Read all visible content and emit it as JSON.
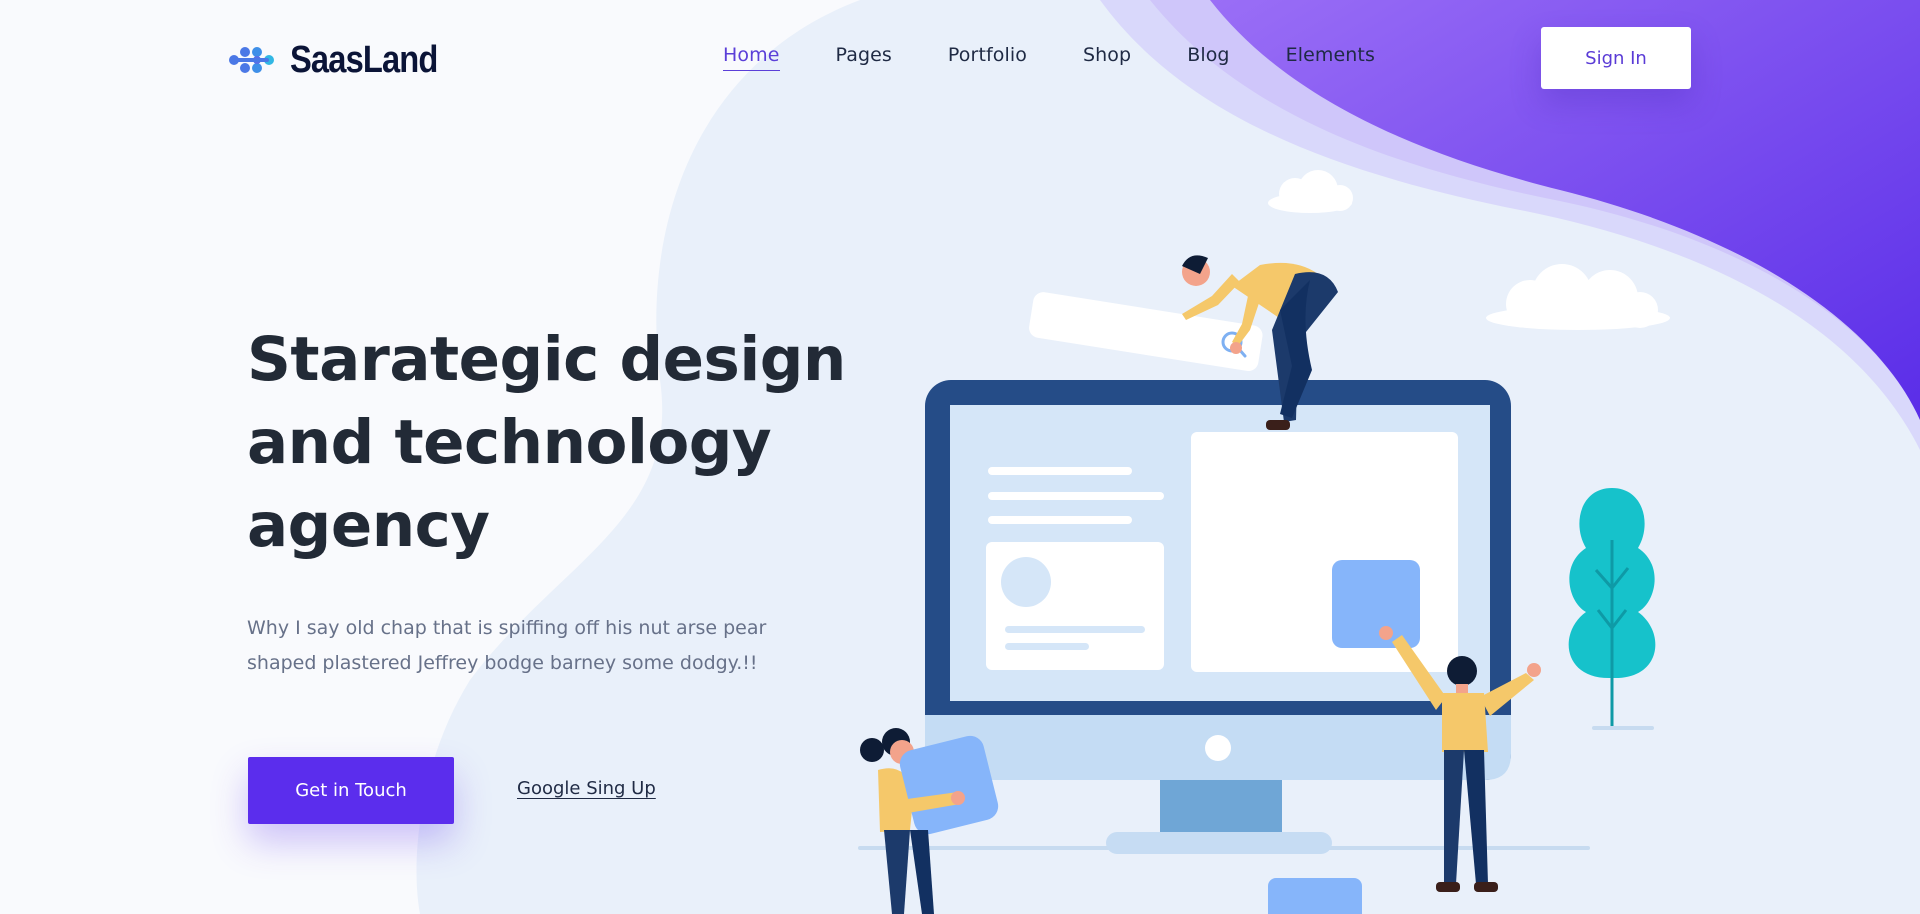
{
  "brand": {
    "name": "SaasLand"
  },
  "nav": {
    "items": [
      {
        "label": "Home",
        "active": true
      },
      {
        "label": "Pages",
        "active": false
      },
      {
        "label": "Portfolio",
        "active": false
      },
      {
        "label": "Shop",
        "active": false
      },
      {
        "label": "Blog",
        "active": false
      },
      {
        "label": "Elements",
        "active": false
      }
    ],
    "signin_label": "Sign In"
  },
  "hero": {
    "title_lines": [
      "Starategic design",
      "and technology",
      "agency"
    ],
    "subtitle_lines": [
      "Why I say old chap that is spiffing off his nut arse pear",
      "shaped plastered Jeffrey bodge barney some dodgy.!!"
    ],
    "cta_label": "Get in Touch",
    "secondary_label": "Google Sing Up"
  },
  "colors": {
    "accent": "#5b2ded",
    "nav_active": "#5b3fd8",
    "heading": "#222a36",
    "body_text": "#677189",
    "wave_start": "#9a6ef6",
    "wave_end": "#5a2de8",
    "monitor_frame": "#254c87",
    "teal_tree": "#16c2cb"
  },
  "icons": {
    "logo": "molecule-dots-icon",
    "search": "magnifier-icon"
  }
}
